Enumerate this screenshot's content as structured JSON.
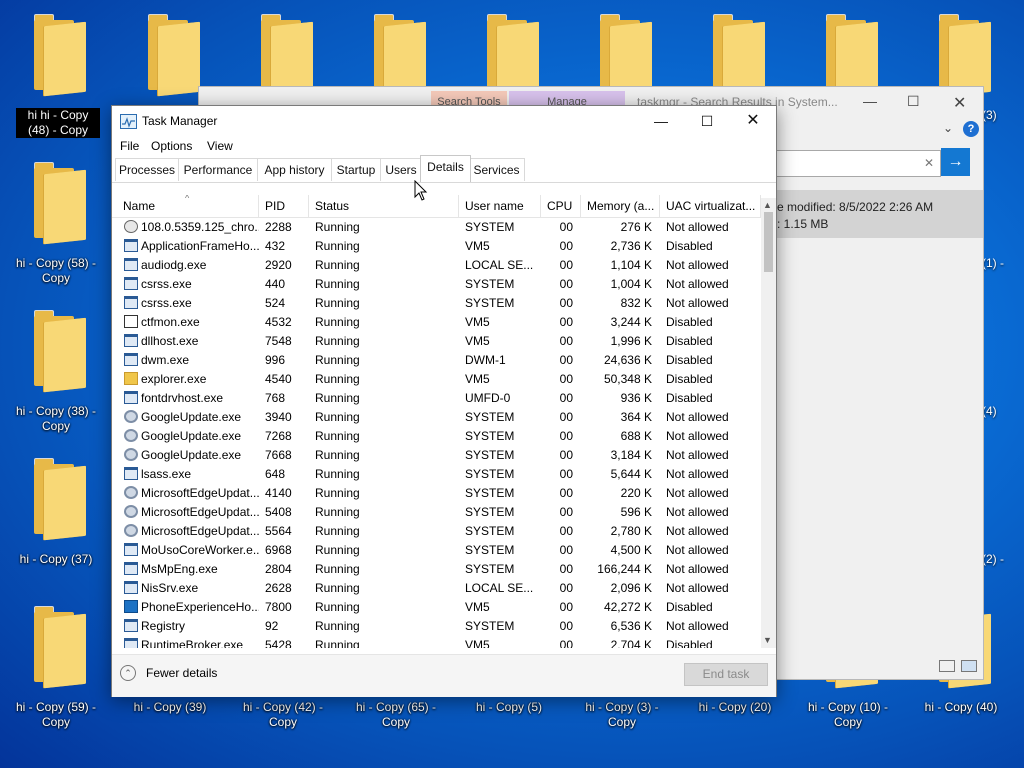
{
  "desktop": {
    "icons": [
      {
        "label": "hi hi - Copy (48) - Copy"
      },
      {
        "label": ""
      },
      {
        "label": ""
      },
      {
        "label": ""
      },
      {
        "label": ""
      },
      {
        "label": ""
      },
      {
        "label": ""
      },
      {
        "label": ""
      },
      {
        "label": ""
      },
      {
        "label": "hi - Copy (58) - Copy"
      },
      {
        "label": "hi - Copy (38) - Copy"
      },
      {
        "label": "hi - Copy (37)"
      },
      {
        "label": "hi - Copy (59) - Copy"
      },
      {
        "label": "hi - Copy (39)"
      },
      {
        "label": "hi - Copy (42) - Copy"
      },
      {
        "label": "hi - Copy (65) - Copy"
      },
      {
        "label": "hi - Copy (5)"
      },
      {
        "label": "hi - Copy (3) - Copy"
      },
      {
        "label": "hi - Copy (20)"
      },
      {
        "label": "hi - Copy (10) - Copy"
      },
      {
        "label": "hi - Copy (40)"
      }
    ],
    "right_edge_labels": [
      "(3)",
      "(1) -",
      "(4)",
      "(2) -"
    ]
  },
  "explorer": {
    "title": "taskmgr - Search Results in System...",
    "tab_search_tools": "Search Tools",
    "tab_manage": "Manage",
    "date_modified": "e modified: 8/5/2022 2:26 AM",
    "size": ": 1.15 MB",
    "go_arrow": "→",
    "clear": "✕",
    "help": "?"
  },
  "taskmanager": {
    "title": "Task Manager",
    "controls": {
      "minimize": "—",
      "maximize": "☐",
      "close": "✕"
    },
    "menu": [
      "File",
      "Options",
      "View"
    ],
    "tabs": [
      "Processes",
      "Performance",
      "App history",
      "Startup",
      "Users",
      "Details",
      "Services"
    ],
    "active_tab": "Details",
    "columns": [
      "Name",
      "PID",
      "Status",
      "User name",
      "CPU",
      "Memory (a...",
      "UAC virtualizat..."
    ],
    "rows": [
      {
        "name": "108.0.5359.125_chro...",
        "pid": "2288",
        "status": "Running",
        "user": "SYSTEM",
        "cpu": "00",
        "mem": "276 K",
        "uac": "Not allowed",
        "icon": "chrome"
      },
      {
        "name": "ApplicationFrameHo...",
        "pid": "432",
        "status": "Running",
        "user": "VM5",
        "cpu": "00",
        "mem": "2,736 K",
        "uac": "Disabled",
        "icon": "app"
      },
      {
        "name": "audiodg.exe",
        "pid": "2920",
        "status": "Running",
        "user": "LOCAL SE...",
        "cpu": "00",
        "mem": "1,104 K",
        "uac": "Not allowed",
        "icon": "app"
      },
      {
        "name": "csrss.exe",
        "pid": "440",
        "status": "Running",
        "user": "SYSTEM",
        "cpu": "00",
        "mem": "1,004 K",
        "uac": "Not allowed",
        "icon": "app"
      },
      {
        "name": "csrss.exe",
        "pid": "524",
        "status": "Running",
        "user": "SYSTEM",
        "cpu": "00",
        "mem": "832 K",
        "uac": "Not allowed",
        "icon": "app"
      },
      {
        "name": "ctfmon.exe",
        "pid": "4532",
        "status": "Running",
        "user": "VM5",
        "cpu": "00",
        "mem": "3,244 K",
        "uac": "Disabled",
        "icon": "pen"
      },
      {
        "name": "dllhost.exe",
        "pid": "7548",
        "status": "Running",
        "user": "VM5",
        "cpu": "00",
        "mem": "1,996 K",
        "uac": "Disabled",
        "icon": "app"
      },
      {
        "name": "dwm.exe",
        "pid": "996",
        "status": "Running",
        "user": "DWM-1",
        "cpu": "00",
        "mem": "24,636 K",
        "uac": "Disabled",
        "icon": "app"
      },
      {
        "name": "explorer.exe",
        "pid": "4540",
        "status": "Running",
        "user": "VM5",
        "cpu": "00",
        "mem": "50,348 K",
        "uac": "Disabled",
        "icon": "folder"
      },
      {
        "name": "fontdrvhost.exe",
        "pid": "768",
        "status": "Running",
        "user": "UMFD-0",
        "cpu": "00",
        "mem": "936 K",
        "uac": "Disabled",
        "icon": "app"
      },
      {
        "name": "GoogleUpdate.exe",
        "pid": "3940",
        "status": "Running",
        "user": "SYSTEM",
        "cpu": "00",
        "mem": "364 K",
        "uac": "Not allowed",
        "icon": "gear"
      },
      {
        "name": "GoogleUpdate.exe",
        "pid": "7268",
        "status": "Running",
        "user": "SYSTEM",
        "cpu": "00",
        "mem": "688 K",
        "uac": "Not allowed",
        "icon": "gear"
      },
      {
        "name": "GoogleUpdate.exe",
        "pid": "7668",
        "status": "Running",
        "user": "SYSTEM",
        "cpu": "00",
        "mem": "3,184 K",
        "uac": "Not allowed",
        "icon": "gear"
      },
      {
        "name": "lsass.exe",
        "pid": "648",
        "status": "Running",
        "user": "SYSTEM",
        "cpu": "00",
        "mem": "5,644 K",
        "uac": "Not allowed",
        "icon": "app"
      },
      {
        "name": "MicrosoftEdgeUpdat...",
        "pid": "4140",
        "status": "Running",
        "user": "SYSTEM",
        "cpu": "00",
        "mem": "220 K",
        "uac": "Not allowed",
        "icon": "gear"
      },
      {
        "name": "MicrosoftEdgeUpdat...",
        "pid": "5408",
        "status": "Running",
        "user": "SYSTEM",
        "cpu": "00",
        "mem": "596 K",
        "uac": "Not allowed",
        "icon": "gear"
      },
      {
        "name": "MicrosoftEdgeUpdat...",
        "pid": "5564",
        "status": "Running",
        "user": "SYSTEM",
        "cpu": "00",
        "mem": "2,780 K",
        "uac": "Not allowed",
        "icon": "gear"
      },
      {
        "name": "MoUsoCoreWorker.e...",
        "pid": "6968",
        "status": "Running",
        "user": "SYSTEM",
        "cpu": "00",
        "mem": "4,500 K",
        "uac": "Not allowed",
        "icon": "app"
      },
      {
        "name": "MsMpEng.exe",
        "pid": "2804",
        "status": "Running",
        "user": "SYSTEM",
        "cpu": "00",
        "mem": "166,244 K",
        "uac": "Not allowed",
        "icon": "app"
      },
      {
        "name": "NisSrv.exe",
        "pid": "2628",
        "status": "Running",
        "user": "LOCAL SE...",
        "cpu": "00",
        "mem": "2,096 K",
        "uac": "Not allowed",
        "icon": "app"
      },
      {
        "name": "PhoneExperienceHo...",
        "pid": "7800",
        "status": "Running",
        "user": "VM5",
        "cpu": "00",
        "mem": "42,272 K",
        "uac": "Disabled",
        "icon": "monitor"
      },
      {
        "name": "Registry",
        "pid": "92",
        "status": "Running",
        "user": "SYSTEM",
        "cpu": "00",
        "mem": "6,536 K",
        "uac": "Not allowed",
        "icon": "app"
      },
      {
        "name": "RuntimeBroker.exe",
        "pid": "5428",
        "status": "Running",
        "user": "VM5",
        "cpu": "00",
        "mem": "2,704 K",
        "uac": "Disabled",
        "icon": "app"
      }
    ],
    "fewer_details": "Fewer details",
    "end_task": "End task"
  }
}
